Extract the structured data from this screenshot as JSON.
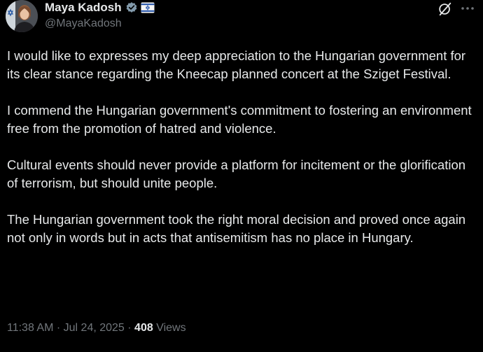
{
  "author": {
    "display_name": "Maya Kadosh",
    "handle": "@MayaKadosh",
    "verified_icon": "verified-badge-icon",
    "flag_icon": "israel-flag-icon"
  },
  "tweet": {
    "paragraphs": [
      "I would like to expresses my deep appreciation to the Hungarian government for its clear stance regarding the Kneecap planned concert at the Sziget Festival.",
      "I commend the Hungarian government's commitment to fostering an environment free from the promotion of hatred and violence.",
      "Cultural events should never provide a platform for incitement or the glorification of terrorism, but should unite people.",
      "The Hungarian government took the right moral decision and proved once again not only in words but in acts that antisemitism has no place in Hungary."
    ]
  },
  "meta": {
    "time": "11:38 AM",
    "separator": " · ",
    "date": "Jul 24, 2025",
    "views_count": "408",
    "views_label": "Views"
  },
  "colors": {
    "background": "#000000",
    "text": "#e7e9ea",
    "secondary": "#71767b",
    "verified": "#829aab"
  }
}
